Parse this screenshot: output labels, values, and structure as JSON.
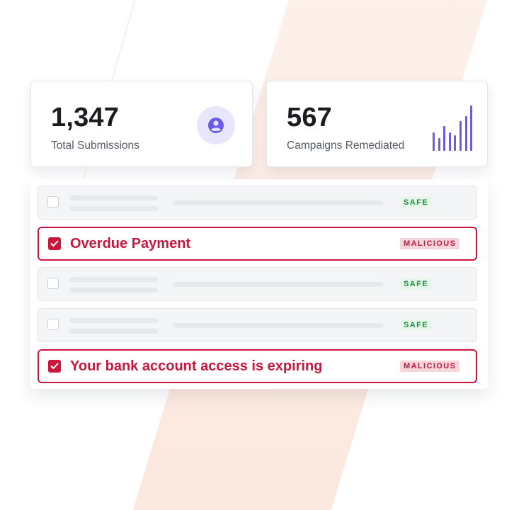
{
  "stats": [
    {
      "value": "1,347",
      "label": "Total Submissions",
      "icon": "user-circle-icon"
    },
    {
      "value": "567",
      "label": "Campaigns Remediated",
      "icon": "bar-chart-icon"
    }
  ],
  "sparkline": {
    "color": "#6b5ce7",
    "levels": [
      0.4,
      0.28,
      0.55,
      0.4,
      0.34,
      0.66,
      0.76,
      1.0
    ]
  },
  "rows": [
    {
      "status": "SAFE",
      "checked": false
    },
    {
      "status": "MALICIOUS",
      "checked": true,
      "subject": "Overdue Payment"
    },
    {
      "status": "SAFE",
      "checked": false
    },
    {
      "status": "SAFE",
      "checked": false
    },
    {
      "status": "MALICIOUS",
      "checked": true,
      "subject": "Your bank account access is expiring"
    }
  ],
  "colors": {
    "accent": "#6b5ce7",
    "malicious": "#c8163d",
    "safe": "#1e8a3c"
  }
}
